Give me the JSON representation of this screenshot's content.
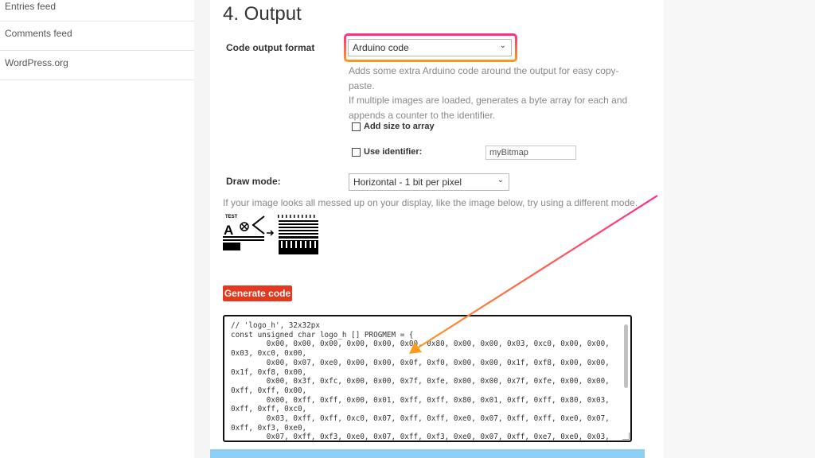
{
  "sidebar": {
    "items": [
      {
        "label": "Entries feed"
      },
      {
        "label": "Comments feed"
      },
      {
        "label": "WordPress.org"
      }
    ]
  },
  "section": {
    "title": "4. Output"
  },
  "output_format": {
    "label": "Code output format",
    "selected": "Arduino code",
    "help_lines": [
      "Adds some extra Arduino code around the output for easy copy-paste.",
      "If multiple images are loaded, generates a byte array for each and",
      "appends a counter to the identifier."
    ]
  },
  "options": {
    "add_size_label": "Add size to array",
    "use_identifier_label": "Use identifier:",
    "identifier_value": "myBitmap"
  },
  "draw_mode": {
    "label": "Draw mode:",
    "selected": "Horizontal - 1 bit per pixel",
    "note": "If your image looks all messed up on your display, like the image below, try using a different mode."
  },
  "example_image": {
    "caption": "TEST"
  },
  "generate_button": {
    "label": "Generate code"
  },
  "code_output": {
    "text": "// 'logo_h', 32x32px\nconst unsigned char logo_h [] PROGMEM = {\n        0x00, 0x00, 0x00, 0x00, 0x00, 0x00, 0x80, 0x00, 0x00, 0x03, 0xc0, 0x00, 0x00,\n0x03, 0xc0, 0x00,\n        0x00, 0x07, 0xe0, 0x00, 0x00, 0x0f, 0xf0, 0x00, 0x00, 0x1f, 0xf8, 0x00, 0x00,\n0x1f, 0xf8, 0x00,\n        0x00, 0x3f, 0xfc, 0x00, 0x00, 0x7f, 0xfe, 0x00, 0x00, 0x7f, 0xfe, 0x00, 0x00,\n0xff, 0xff, 0x00,\n        0x00, 0xff, 0xff, 0x00, 0x01, 0xff, 0xff, 0x80, 0x01, 0xff, 0xff, 0x80, 0x03,\n0xff, 0xff, 0xc0,\n        0x03, 0xff, 0xff, 0xc0, 0x07, 0xff, 0xff, 0xe0, 0x07, 0xff, 0xff, 0xe0, 0x07,\n0xff, 0xf3, 0xe0,\n        0x07, 0xff, 0xf3, 0xe0, 0x07, 0xff, 0xf3, 0xe0, 0x07, 0xff, 0xe7, 0xe0, 0x03,"
  },
  "colors": {
    "accent_button": "#e33a1f",
    "highlight_gradient_top": "#ff2a8c",
    "highlight_gradient_bottom": "#ff9a1a",
    "arrow_start": "#ff2a8c",
    "arrow_end": "#ff9a1a",
    "bottom_bar": "#8ecff4"
  }
}
